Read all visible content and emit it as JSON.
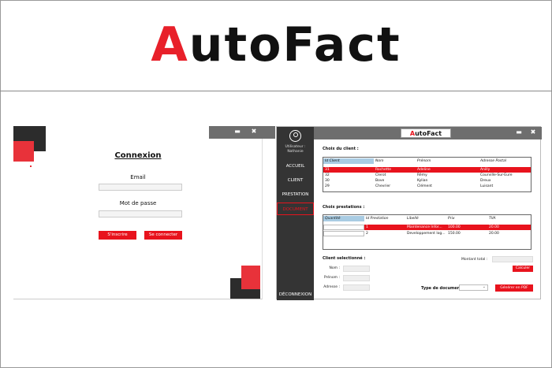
{
  "brand": {
    "prefix": "A",
    "rest": "utoFact"
  },
  "login": {
    "title": "Connexion",
    "email_label": "Email",
    "password_label": "Mot de passe",
    "register_label": "S'inscrire",
    "login_label": "Se connecter"
  },
  "app": {
    "logo_prefix": "A",
    "logo_rest": "utoFact",
    "user_label_1": "Utilisateur :",
    "user_label_2": "Nathanie",
    "nav": [
      {
        "label": "ACCUEIL"
      },
      {
        "label": "CLIENT"
      },
      {
        "label": "PRESTATION"
      },
      {
        "label": "DOCUMENT"
      }
    ],
    "logout_label": "DÉCONNEXION",
    "client_section": "Choix du client :",
    "client_table": {
      "headers": [
        "Id Client",
        "Nom",
        "Prénom",
        "Adresse Postal"
      ],
      "rows": [
        [
          "31",
          "Rochette",
          "Adeline",
          "Anilly"
        ],
        [
          "32",
          "Clerot",
          "Rémy",
          "Courville-Sur-Eure"
        ],
        [
          "30",
          "Bove",
          "Kylian",
          "Dreux"
        ],
        [
          "29",
          "Chevrier",
          "Clément",
          "Luisant"
        ]
      ]
    },
    "presta_section": "Choix prestations :",
    "presta_table": {
      "headers": [
        "Quantité",
        "Id Prestation",
        "Libellé",
        "Prix",
        "TVA"
      ],
      "rows": [
        [
          "",
          "1",
          "Maintenance Infor...",
          "100.00",
          "20.00"
        ],
        [
          "",
          "2",
          "Developpement log...",
          "150.00",
          "20.00"
        ]
      ]
    },
    "selected_client_label": "Client selectionné :",
    "name_label": "Nom :",
    "firstname_label": "Prénom :",
    "address_label": "Adresse :",
    "total_label": "Montant total :",
    "calc_label": "Calculer",
    "doctype_label": "Type de document :",
    "pdf_label": "Générer en PDF"
  }
}
